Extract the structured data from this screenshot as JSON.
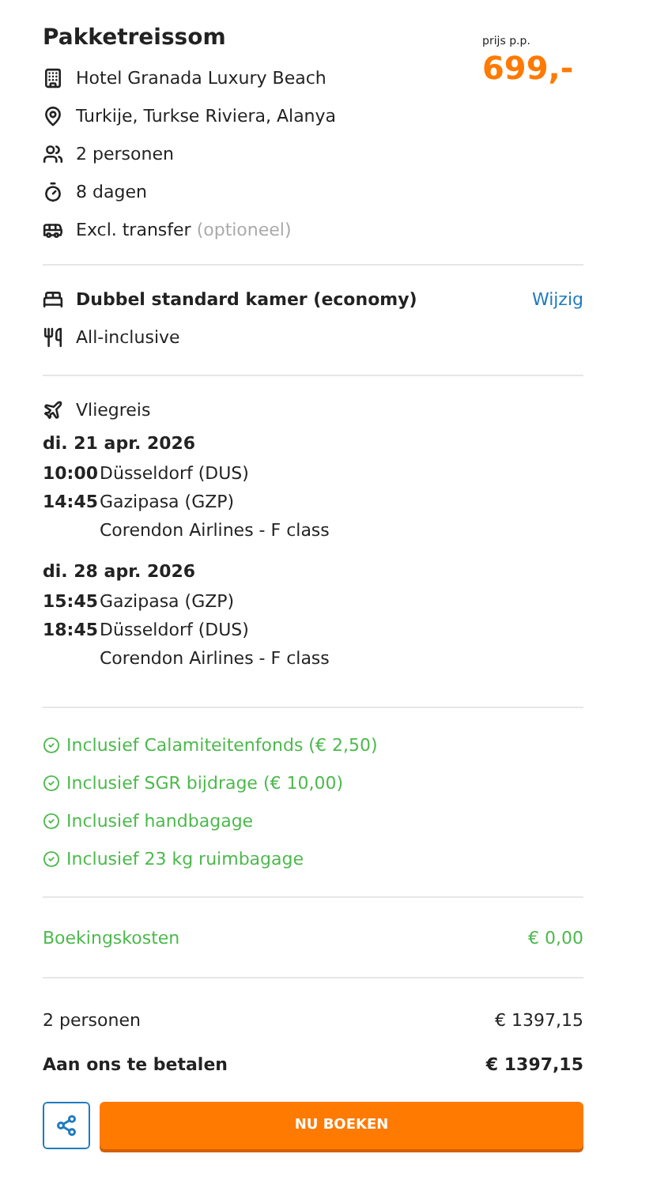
{
  "title": "Pakketreissom",
  "price": {
    "caption": "prijs p.p.",
    "amount": "699,-"
  },
  "details": [
    {
      "kind": "hotel",
      "text": "Hotel Granada Luxury Beach"
    },
    {
      "kind": "location",
      "text": "Turkije, Turkse Riviera, Alanya"
    },
    {
      "kind": "persons",
      "text": "2 personen"
    },
    {
      "kind": "duration",
      "text": "8 dagen"
    },
    {
      "kind": "transfer",
      "text": "Excl. transfer",
      "note": "(optioneel)"
    }
  ],
  "room": {
    "text": "Dubbel standard kamer (economy)",
    "link": "Wijzig"
  },
  "board": {
    "text": "All-inclusive"
  },
  "flight": {
    "title": "Vliegreis",
    "legs": [
      {
        "date": "di. 21 apr. 2026",
        "departure_time": "10:00",
        "departure": "Düsseldorf (DUS)",
        "arrival_time": "14:45",
        "arrival": "Gazipasa (GZP)",
        "carrier": "Corendon Airlines - F class"
      },
      {
        "date": "di. 28 apr. 2026",
        "departure_time": "15:45",
        "departure": "Gazipasa (GZP)",
        "arrival_time": "18:45",
        "arrival": "Düsseldorf (DUS)",
        "carrier": "Corendon Airlines - F class"
      }
    ]
  },
  "inclusions": [
    "Inclusief Calamiteitenfonds (€ 2,50)",
    "Inclusief SGR bijdrage (€ 10,00)",
    "Inclusief handbagage",
    "Inclusief 23 kg ruimbagage"
  ],
  "booking_costs": {
    "label": "Boekingskosten",
    "amount": "€ 0,00"
  },
  "totals": [
    {
      "label": "2 personen",
      "amount": "€ 1397,15",
      "emphasis": false
    },
    {
      "label": "Aan ons te betalen",
      "amount": "€ 1397,15",
      "emphasis": true
    }
  ],
  "book_button": "NU BOEKEN"
}
